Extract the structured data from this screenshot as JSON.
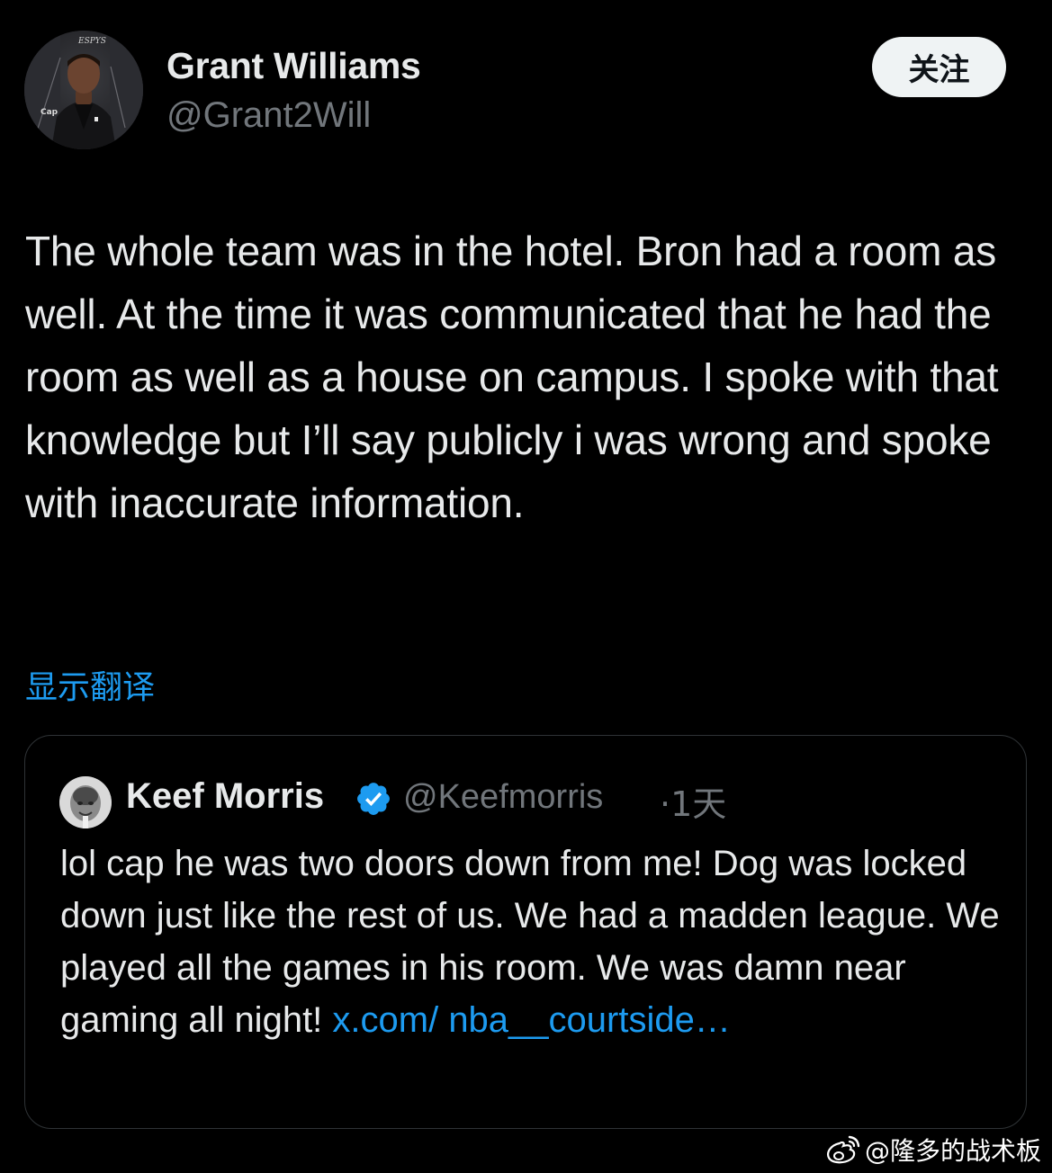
{
  "author": {
    "display_name": "Grant Williams",
    "handle": "@Grant2Will",
    "avatar_icon": "person-photo"
  },
  "follow_button_label": "关注",
  "tweet": {
    "text": "The whole team was in the hotel. Bron had a room as well. At the time it was communicated that he had the room as well as a house on campus. I spoke with that knowledge but I’ll say publicly i was wrong and spoke with inaccurate information."
  },
  "translate_label": "显示翻译",
  "quoted_tweet": {
    "display_name": "Keef Morris",
    "verified": true,
    "verified_color": "#1d9bf0",
    "handle": "@Keefmorris",
    "time": "·1天",
    "text": "lol cap he was two doors down from me! Dog was locked down just like the rest of us. We had a madden league. We played all the games in his room. We was damn near gaming all night! ",
    "link": "x.com/ nba__courtside…"
  },
  "watermark": {
    "text": "@隆多的战术板",
    "icon": "weibo-icon"
  },
  "colors": {
    "background": "#000000",
    "text_primary": "#e7e9ea",
    "text_secondary": "#71767b",
    "accent": "#1d9bf0",
    "border": "#2f3336"
  }
}
